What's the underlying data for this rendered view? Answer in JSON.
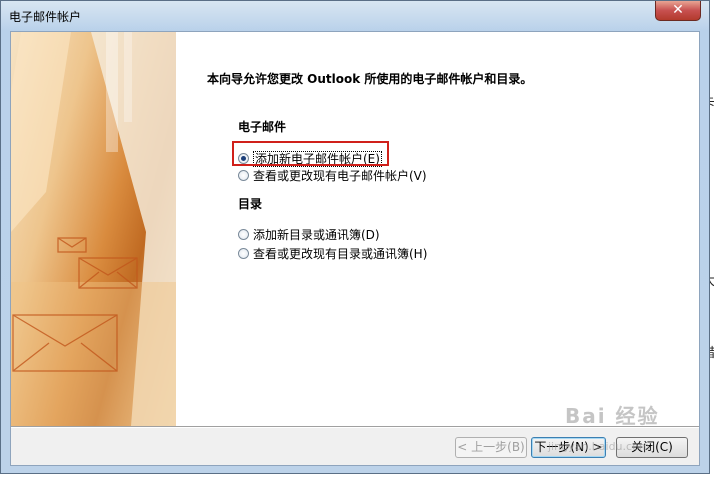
{
  "window": {
    "title": "电子邮件帐户",
    "close_label": "✕"
  },
  "intro": {
    "text": "本向导允许您更改 Outlook 所使用的电子邮件帐户和目录。"
  },
  "email_section": {
    "heading": "电子邮件",
    "options": [
      {
        "label": "添加新电子邮件帐户(E)",
        "selected": true
      },
      {
        "label": "查看或更改现有电子邮件帐户(V)",
        "selected": false
      }
    ]
  },
  "directory_section": {
    "heading": "目录",
    "options": [
      {
        "label": "添加新目录或通讯簿(D)",
        "selected": false
      },
      {
        "label": "查看或更改现有目录或通讯簿(H)",
        "selected": false
      }
    ]
  },
  "buttons": {
    "back": "< 上一步(B)",
    "next": "下一步(N) >",
    "close": "关闭(C)"
  },
  "watermark": {
    "text": "Bai 经验",
    "sub": "jingyan.baidu.com"
  },
  "background_page": {
    "chars": [
      "卡",
      "》",
      "大",
      "。",
      "措"
    ]
  },
  "colors": {
    "highlight_box": "#d0201a",
    "banner_accent": "#d98b3e"
  }
}
